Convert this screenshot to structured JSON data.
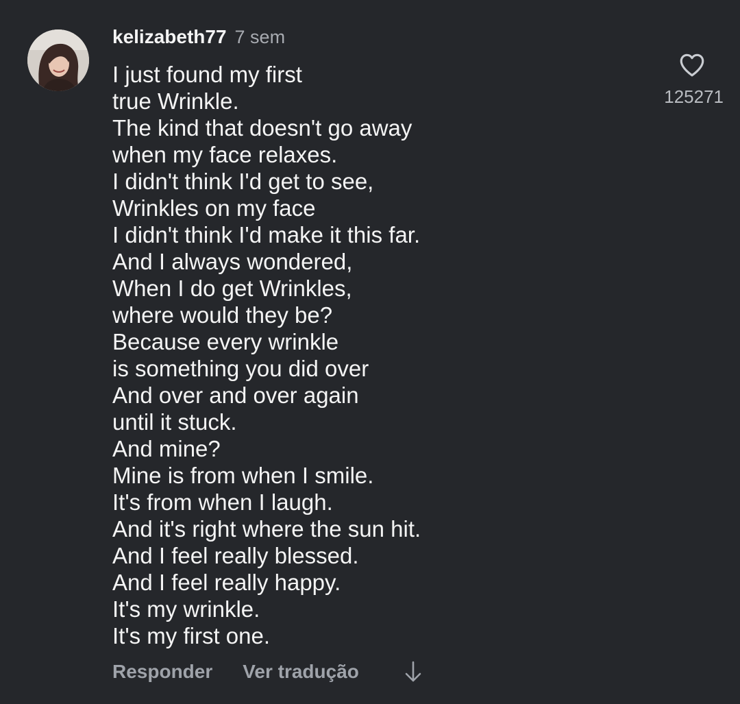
{
  "comment": {
    "username": "kelizabeth77",
    "timestamp": "7 sem",
    "avatar_icon": "user-avatar-photo",
    "lines": [
      "I just found my first",
      "true Wrinkle.",
      "The kind that doesn't go away",
      "when my face relaxes.",
      "I didn't think I'd get to see,",
      "Wrinkles on my face",
      "I didn't think I'd make it this far.",
      "And I always wondered,",
      "When I do get Wrinkles,",
      "where would they be?",
      "Because every wrinkle",
      "is something you did over",
      "And over and over again",
      "until it stuck.",
      "And mine?",
      "Mine is from when I smile.",
      "It's from when I laugh.",
      "And it's right where the sun hit.",
      "And I feel really blessed.",
      "And I feel really happy.",
      "It's my wrinkle.",
      "It's my first one."
    ],
    "like": {
      "icon": "heart-outline-icon",
      "count": "125271"
    },
    "actions": {
      "reply_label": "Responder",
      "translate_label": "Ver tradução",
      "expand_icon": "arrow-down-icon"
    }
  },
  "colors": {
    "background": "#25272b",
    "text": "#f4f4f4",
    "muted": "#9fa3aa"
  }
}
